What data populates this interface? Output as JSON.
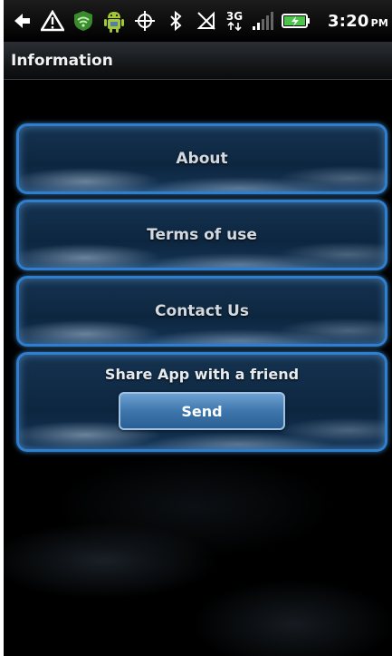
{
  "status_bar": {
    "icons": [
      "back-arrow-icon",
      "warning-icon",
      "wifi-shield-icon",
      "android-icon",
      "gps-crosshair-icon",
      "bluetooth-icon",
      "signal-off-icon",
      "3g-data-icon",
      "signal-bars-icon",
      "battery-charging-icon"
    ],
    "network_label": "3G",
    "time": "3:20",
    "ampm": "PM"
  },
  "title_bar": {
    "title": "Information"
  },
  "menu": {
    "items": [
      {
        "label": "About"
      },
      {
        "label": "Terms of use"
      },
      {
        "label": "Contact Us"
      }
    ],
    "share": {
      "label": "Share App with a friend",
      "button_label": "Send"
    }
  },
  "colors": {
    "accent_border": "#2f7fcf",
    "button_blue": "#3e77ad",
    "background": "#000000"
  }
}
